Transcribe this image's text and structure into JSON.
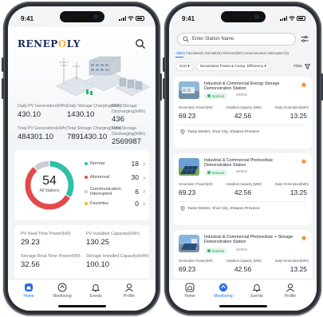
{
  "left": {
    "status_time": "9:41",
    "logo_main_a": "RENEP",
    "logo_accent": "O",
    "logo_main_b": "LY",
    "metrics": [
      {
        "label": "Daily PV Generation(kWh)",
        "value": "430.10"
      },
      {
        "label": "Daily Storage Charging(kWh)",
        "value": "1430.10"
      },
      {
        "label": "Daily Storage Discharging(kWh)",
        "value": "436"
      },
      {
        "label": "Total PV Generation(kWh)",
        "value": "484301.10"
      },
      {
        "label": "Total Storage Charging(kWh)",
        "value": "7891430.10"
      },
      {
        "label": "Total Storage Discharging(kWh)",
        "value": "2569987"
      }
    ],
    "donut": {
      "total": "54",
      "caption": "All Stations",
      "segments": [
        {
          "name": "Normal",
          "count": 18,
          "color": "#2fbfa8"
        },
        {
          "name": "Abnormal",
          "count": 30,
          "color": "#e24a4a"
        },
        {
          "name": "Communication Interrupted",
          "count": 6,
          "color": "#c7ccd4"
        },
        {
          "name": "Favorites",
          "count": 0,
          "color": "#f0b429"
        }
      ]
    },
    "power": [
      {
        "label": "PV Real-Time Power(kW)",
        "value": "29.23"
      },
      {
        "label": "PV Installed Capacity(kWh)",
        "value": "130.25"
      },
      {
        "label": "Storage Real-Time Power(kW)",
        "value": "32.56"
      },
      {
        "label": "Storage Installed Capacity(kWh)",
        "value": "100.10"
      }
    ],
    "tabs": [
      {
        "label": "Home",
        "icon": "home-icon",
        "active": true
      },
      {
        "label": "Monitoring",
        "icon": "monitoring-icon",
        "active": false
      },
      {
        "label": "Events",
        "icon": "bell-icon",
        "active": false
      },
      {
        "label": "Profile",
        "icon": "profile-icon",
        "active": false
      }
    ]
  },
  "right": {
    "status_time": "9:41",
    "search_placeholder": "Enter Station Name",
    "filter_tabs": {
      "all": "All(54)",
      "rest": "  Favorites(0)  Normal(18)  Abnormal(30)  Communication Interrupted (6)"
    },
    "sort_label": "Sort",
    "sort_field": "Generation Power",
    "sort_field2": "Comp. Efficiency",
    "filter_label": "Filter",
    "column_labels": [
      "Generation Power(kW)",
      "Installed Capacity (MW)",
      "Daily Generation(kWh)"
    ],
    "stations": [
      {
        "name": "Industrial & Commercial Energy Storage Demonstration Station",
        "status": "Normal",
        "rated": "50MW",
        "generation_power": "69.23",
        "installed_capacity": "42.56",
        "daily_generation": "13.25",
        "address": "Yanta District, Xi'an City, Shaanxi Province"
      },
      {
        "name": "Industrial & Commercial Photovoltaic Demonstration Station",
        "status": "Normal",
        "rated": "50MW",
        "generation_power": "69.23",
        "installed_capacity": "42.56",
        "daily_generation": "13.25",
        "address": "Yanta District, Xi'an City, Shaanxi Province"
      },
      {
        "name": "Industrial & Commercial Photovoltaic + Storage Demonstration Station",
        "status": "Normal",
        "rated": "50MW",
        "generation_power": "69.23",
        "installed_capacity": "42.56",
        "daily_generation": "13.25"
      }
    ],
    "tabs": [
      {
        "label": "Home",
        "icon": "home-icon",
        "active": false
      },
      {
        "label": "Monitoring",
        "icon": "monitoring-icon",
        "active": true
      },
      {
        "label": "Events",
        "icon": "bell-icon",
        "active": false
      },
      {
        "label": "Profile",
        "icon": "profile-icon",
        "active": false
      }
    ]
  },
  "colors": {
    "accent_blue": "#2d6fdc",
    "normal_green": "#2fb36a",
    "favorite_orange": "#f08a24",
    "logo_navy": "#1a2a5a"
  }
}
